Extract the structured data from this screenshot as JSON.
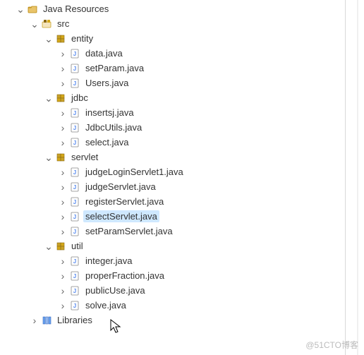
{
  "root": {
    "label": "Java Resources",
    "children": [
      {
        "label": "src",
        "icon": "src-folder",
        "expanded": true,
        "children": [
          {
            "label": "entity",
            "icon": "package",
            "expanded": true,
            "children": [
              {
                "label": "data.java",
                "icon": "java-file"
              },
              {
                "label": "setParam.java",
                "icon": "java-file"
              },
              {
                "label": "Users.java",
                "icon": "java-file"
              }
            ]
          },
          {
            "label": "jdbc",
            "icon": "package",
            "expanded": true,
            "children": [
              {
                "label": "insertsj.java",
                "icon": "java-file"
              },
              {
                "label": "JdbcUtils.java",
                "icon": "java-file"
              },
              {
                "label": "select.java",
                "icon": "java-file"
              }
            ]
          },
          {
            "label": "servlet",
            "icon": "package",
            "expanded": true,
            "children": [
              {
                "label": "judgeLoginServlet1.java",
                "icon": "java-file"
              },
              {
                "label": "judgeServlet.java",
                "icon": "java-file"
              },
              {
                "label": "registerServlet.java",
                "icon": "java-file"
              },
              {
                "label": "selectServlet.java",
                "icon": "java-file",
                "selected": true
              },
              {
                "label": "setParamServlet.java",
                "icon": "java-file"
              }
            ]
          },
          {
            "label": "util",
            "icon": "package",
            "expanded": true,
            "children": [
              {
                "label": "integer.java",
                "icon": "java-file"
              },
              {
                "label": "properFraction.java",
                "icon": "java-file"
              },
              {
                "label": "publicUse.java",
                "icon": "java-file"
              },
              {
                "label": "solve.java",
                "icon": "java-file"
              }
            ]
          }
        ]
      },
      {
        "label": "Libraries",
        "icon": "library",
        "expanded": false
      }
    ]
  },
  "watermark": "@51CTO博客"
}
